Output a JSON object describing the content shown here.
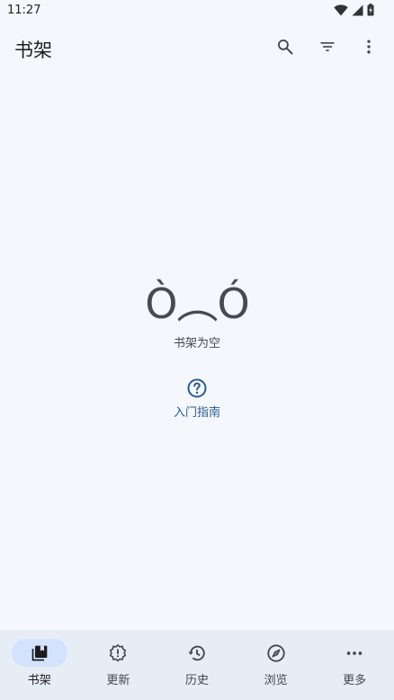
{
  "status_bar": {
    "time": "11:27"
  },
  "app_bar": {
    "title": "书架",
    "actions": [
      "search-icon",
      "filter-icon",
      "more-vert-icon"
    ]
  },
  "empty_state": {
    "face": "Ò︵Ó",
    "message": "书架为空",
    "guide_link": "入门指南"
  },
  "bottom_nav": {
    "items": [
      {
        "label": "书架",
        "icon": "library-icon",
        "active": true
      },
      {
        "label": "更新",
        "icon": "updates-icon",
        "active": false
      },
      {
        "label": "历史",
        "icon": "history-icon",
        "active": false
      },
      {
        "label": "浏览",
        "icon": "explore-icon",
        "active": false
      },
      {
        "label": "更多",
        "icon": "more-horiz-icon",
        "active": false
      }
    ]
  },
  "colors": {
    "background": "#f4f8fc",
    "nav_background": "#e7edf5",
    "active_pill": "#d3e3fd",
    "link": "#2c5a8e"
  }
}
